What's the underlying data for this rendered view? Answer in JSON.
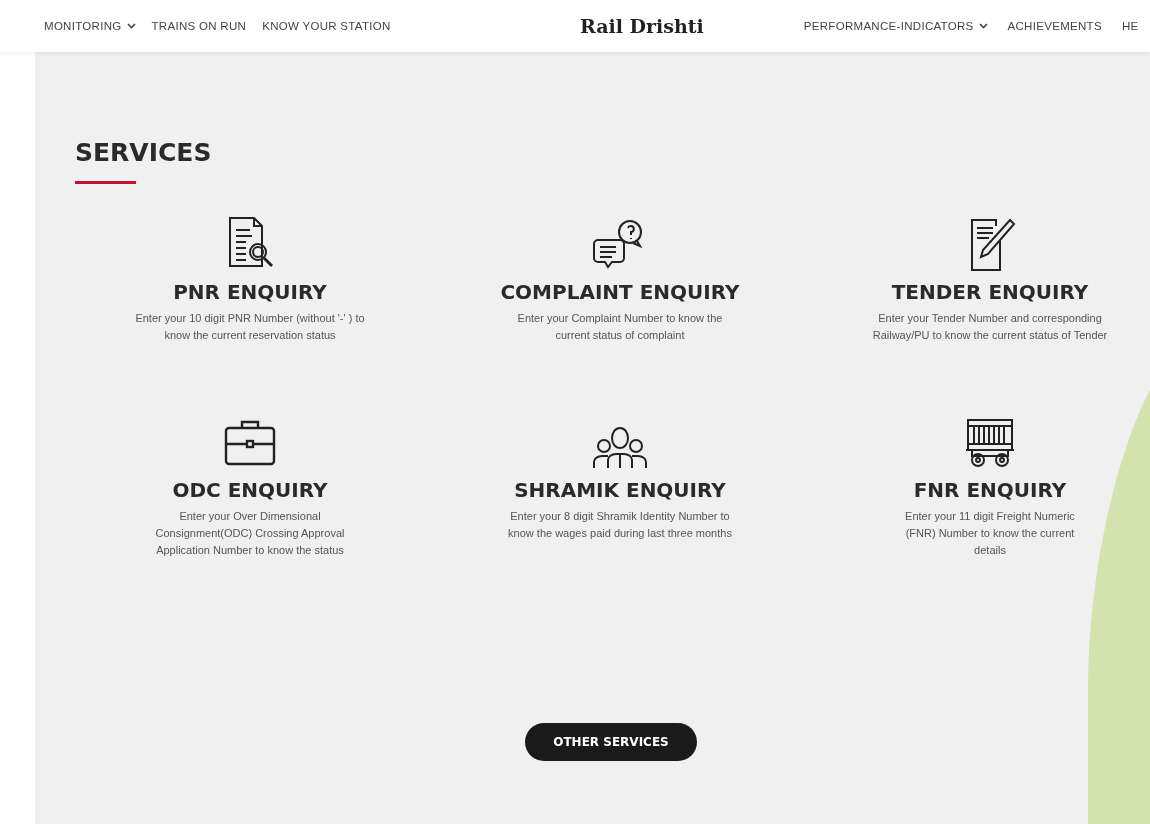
{
  "nav": {
    "left": [
      {
        "label": "MONITORING",
        "dropdown": true
      },
      {
        "label": "TRAINS ON RUN",
        "dropdown": false
      },
      {
        "label": "KNOW YOUR STATION",
        "dropdown": false
      }
    ],
    "brand": "Rail Drishti",
    "right": [
      {
        "label": "PERFORMANCE-INDICATORS",
        "dropdown": true
      },
      {
        "label": "ACHIEVEMENTS",
        "dropdown": false
      },
      {
        "label": "HE",
        "dropdown": false
      }
    ]
  },
  "services": {
    "title": "SERVICES",
    "items": [
      {
        "kind": "document-search",
        "title": "PNR ENQUIRY",
        "description": "Enter your 10 digit PNR Number (without '-' ) to know the current reservation status"
      },
      {
        "kind": "chat-question",
        "title": "COMPLAINT ENQUIRY",
        "description": "Enter your Complaint Number to know the current status of complaint"
      },
      {
        "kind": "note-pencil",
        "title": "TENDER ENQUIRY",
        "description": "Enter your Tender Number and corresponding Railway/PU to know the current status of Tender"
      },
      {
        "kind": "briefcase",
        "title": "ODC ENQUIRY",
        "description": "Enter your Over Dimensional Consignment(ODC) Crossing Approval Application Number to know the status"
      },
      {
        "kind": "people",
        "title": "SHRAMIK ENQUIRY",
        "description": "Enter your 8 digit Shramik Identity Number to know the wages paid during last three months"
      },
      {
        "kind": "wagon",
        "title": "FNR ENQUIRY",
        "description": "Enter your 11 digit Freight Numeric (FNR) Number to know the current details"
      }
    ],
    "button": "OTHER SERVICES"
  }
}
